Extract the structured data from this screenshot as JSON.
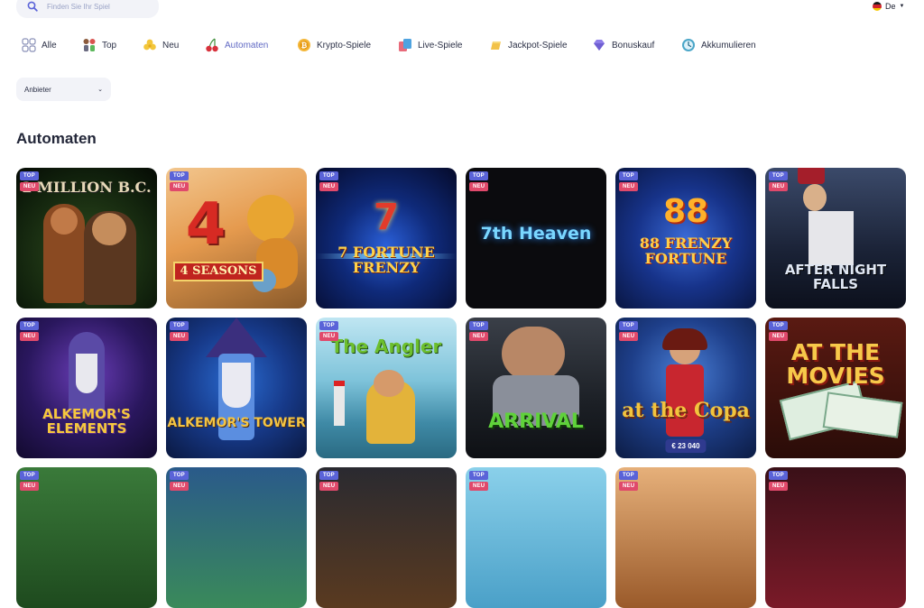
{
  "search": {
    "placeholder": "Finden Sie Ihr Spiel"
  },
  "language": {
    "label": "De"
  },
  "categories": [
    {
      "label": "Alle",
      "icon": "grid-icon"
    },
    {
      "label": "Top",
      "icon": "top-icon"
    },
    {
      "label": "Neu",
      "icon": "clover-icon"
    },
    {
      "label": "Automaten",
      "icon": "cherries-icon",
      "active": true
    },
    {
      "label": "Krypto-Spiele",
      "icon": "bitcoin-icon"
    },
    {
      "label": "Live-Spiele",
      "icon": "cards-icon"
    },
    {
      "label": "Jackpot-Spiele",
      "icon": "gold-bar-icon"
    },
    {
      "label": "Bonuskauf",
      "icon": "diamond-icon"
    },
    {
      "label": "Akkumulieren",
      "icon": "clock-icon"
    }
  ],
  "filter": {
    "label": "Anbieter"
  },
  "section": {
    "title": "Automaten"
  },
  "badges": {
    "top": "TOP",
    "neu": "NEU"
  },
  "games": [
    {
      "title": "2 MILLION B.C."
    },
    {
      "title": "4 SEASONS"
    },
    {
      "title": "7 FORTUNE FRENZY"
    },
    {
      "title": "7th Heaven"
    },
    {
      "title": "88 FRENZY FORTUNE"
    },
    {
      "title": "AFTER NIGHT FALLS"
    },
    {
      "title": "ALKEMOR'S ELEMENTS"
    },
    {
      "title": "ALKEMOR'S TOWER"
    },
    {
      "title": "The Angler"
    },
    {
      "title": "ARRIVAL"
    },
    {
      "title": "at the Copa",
      "jackpot": "€ 23 040"
    },
    {
      "title": "AT THE MOVIES"
    },
    {
      "title": ""
    },
    {
      "title": ""
    },
    {
      "title": ""
    },
    {
      "title": ""
    },
    {
      "title": ""
    },
    {
      "title": ""
    }
  ],
  "colors": {
    "accent": "#6069c4",
    "badge_top": "#5a63d8",
    "badge_neu": "#e0496b"
  }
}
